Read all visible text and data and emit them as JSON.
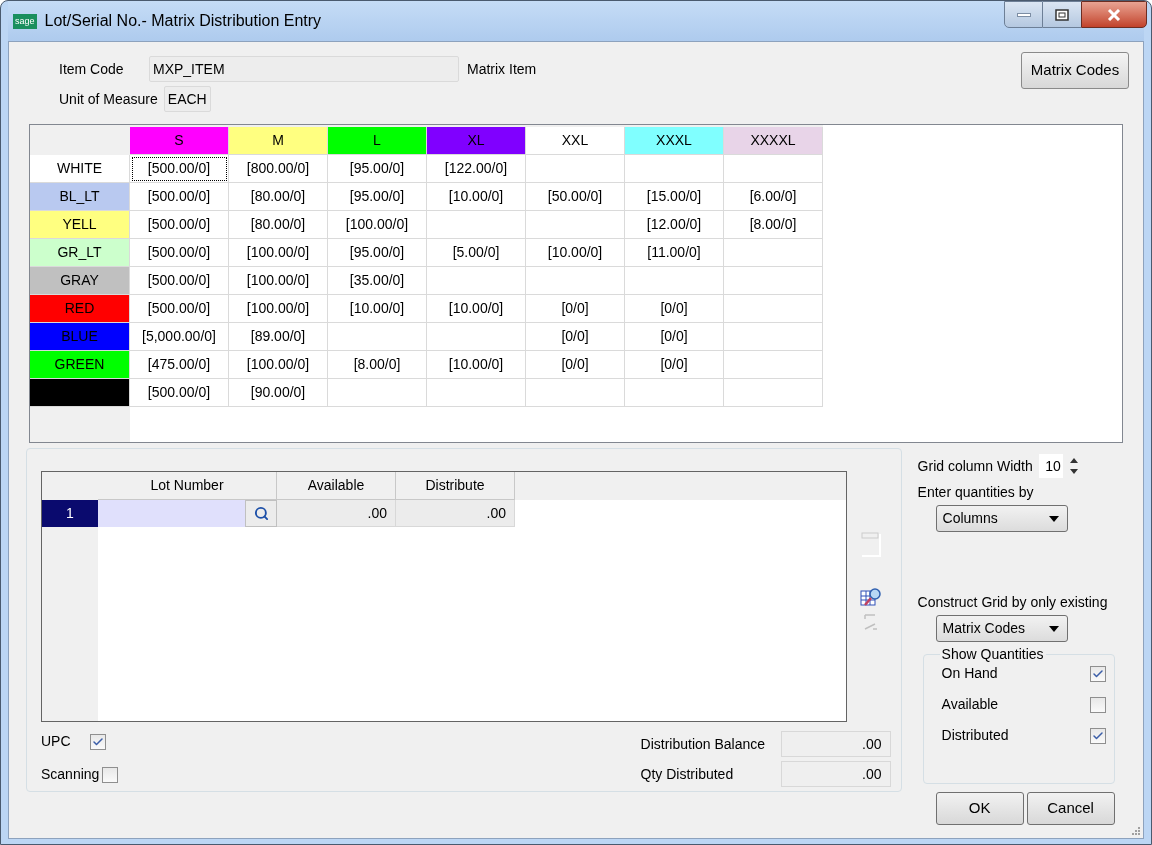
{
  "window": {
    "logo": "sage",
    "title": "Lot/Serial No.- Matrix Distribution Entry"
  },
  "item_code": {
    "label": "Item Code",
    "value": "MXP_ITEM",
    "description": "Matrix Item"
  },
  "unit_of_measure": {
    "label": "Unit of Measure",
    "value": "EACH"
  },
  "matrix_codes_button": "Matrix Codes",
  "matrix": {
    "columns": [
      {
        "label": "S",
        "color": "#ff00ff"
      },
      {
        "label": "M",
        "color": "#ffff80"
      },
      {
        "label": "L",
        "color": "#00ff00"
      },
      {
        "label": "XL",
        "color": "#8000ff"
      },
      {
        "label": "XXL",
        "color": "#ffffff"
      },
      {
        "label": "XXXL",
        "color": "#80ffff"
      },
      {
        "label": "XXXXL",
        "color": "#e8d4e8"
      }
    ],
    "rows": [
      {
        "label": "WHITE",
        "color": "#ffffff",
        "cells": [
          {
            "text": "[500.00/0]",
            "focused": true
          },
          {
            "text": "[800.00/0]",
            "focused": false
          },
          {
            "text": "[95.00/0]",
            "focused": false
          },
          {
            "text": "[122.00/0]",
            "focused": false
          },
          null,
          null,
          null
        ]
      },
      {
        "label": "BL_LT",
        "color": "#b9c9f0",
        "cells": [
          {
            "text": "[500.00/0]",
            "focused": false
          },
          {
            "text": "[80.00/0]",
            "focused": false
          },
          {
            "text": "[95.00/0]",
            "focused": false
          },
          {
            "text": "[10.00/0]",
            "focused": false
          },
          {
            "text": "[50.00/0]",
            "focused": false
          },
          {
            "text": "[15.00/0]",
            "focused": false
          },
          {
            "text": "[6.00/0]",
            "focused": false
          }
        ]
      },
      {
        "label": "YELL",
        "color": "#ffff80",
        "cells": [
          {
            "text": "[500.00/0]",
            "focused": false
          },
          {
            "text": "[80.00/0]",
            "focused": false
          },
          {
            "text": "[100.00/0]",
            "focused": false
          },
          null,
          null,
          {
            "text": "[12.00/0]",
            "focused": false
          },
          {
            "text": "[8.00/0]",
            "focused": false
          }
        ]
      },
      {
        "label": "GR_LT",
        "color": "#ccffcc",
        "cells": [
          {
            "text": "[500.00/0]",
            "focused": false
          },
          {
            "text": "[100.00/0]",
            "focused": false
          },
          {
            "text": "[95.00/0]",
            "focused": false
          },
          {
            "text": "[5.00/0]",
            "focused": false
          },
          {
            "text": "[10.00/0]",
            "focused": false
          },
          {
            "text": "[11.00/0]",
            "focused": false
          },
          null
        ]
      },
      {
        "label": "GRAY",
        "color": "#c0c0c0",
        "cells": [
          {
            "text": "[500.00/0]",
            "focused": false
          },
          {
            "text": "[100.00/0]",
            "focused": false
          },
          {
            "text": "[35.00/0]",
            "focused": false
          },
          null,
          null,
          null,
          null
        ]
      },
      {
        "label": "RED",
        "color": "#ff0000",
        "cells": [
          {
            "text": "[500.00/0]",
            "focused": false
          },
          {
            "text": "[100.00/0]",
            "focused": false
          },
          {
            "text": "[10.00/0]",
            "focused": false
          },
          {
            "text": "[10.00/0]",
            "focused": false
          },
          {
            "text": "[0/0]",
            "focused": false
          },
          {
            "text": "[0/0]",
            "focused": false
          },
          null
        ]
      },
      {
        "label": "BLUE",
        "color": "#0000ff",
        "cells": [
          {
            "text": "[5,000.00/0]",
            "focused": false
          },
          {
            "text": "[89.00/0]",
            "focused": false
          },
          null,
          null,
          {
            "text": "[0/0]",
            "focused": false
          },
          {
            "text": "[0/0]",
            "focused": false
          },
          null
        ]
      },
      {
        "label": "GREEN",
        "color": "#00ff00",
        "cells": [
          {
            "text": "[475.00/0]",
            "focused": false
          },
          {
            "text": "[100.00/0]",
            "focused": false
          },
          {
            "text": "[8.00/0]",
            "focused": false
          },
          {
            "text": "[10.00/0]",
            "focused": false
          },
          {
            "text": "[0/0]",
            "focused": false
          },
          {
            "text": "[0/0]",
            "focused": false
          },
          null
        ]
      },
      {
        "color": "#000000",
        "cells": [
          {
            "text": "[500.00/0]",
            "focused": false
          },
          {
            "text": "[90.00/0]",
            "focused": false
          },
          null,
          null,
          null,
          null,
          null
        ]
      }
    ]
  },
  "lots": {
    "columns": [
      "Lot Number",
      "Available",
      "Distribute"
    ],
    "rows": [
      {
        "number": "1",
        "selected": true,
        "available": ".00",
        "distribute": ".00"
      }
    ]
  },
  "upc": {
    "label": "UPC",
    "checked": true
  },
  "scanning": {
    "label": "Scanning",
    "checked": false
  },
  "distribution_balance": {
    "label": "Distribution Balance",
    "value": ".00"
  },
  "qty_distributed": {
    "label": "Qty Distributed",
    "value": ".00"
  },
  "grid_column_width": {
    "label": "Grid column Width",
    "value": "10"
  },
  "enter_quantities_by": {
    "label": "Enter quantities by",
    "value": "Columns"
  },
  "construct_grid": {
    "label": "Construct Grid by only existing",
    "value": "Matrix Codes"
  },
  "show_quantities": {
    "title": "Show Quantities",
    "options": [
      {
        "label": "On Hand",
        "checked": true
      },
      {
        "label": "Available",
        "checked": false
      },
      {
        "label": "Distributed",
        "checked": true
      }
    ]
  },
  "buttons": [
    {
      "label": "OK"
    },
    {
      "label": "Cancel"
    }
  ]
}
